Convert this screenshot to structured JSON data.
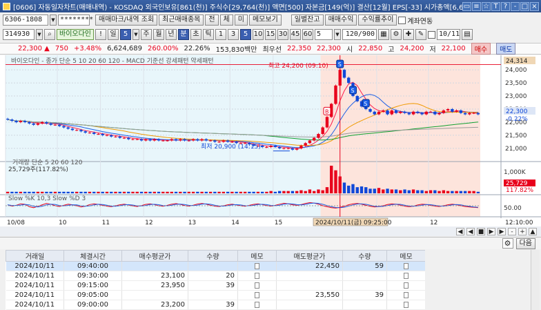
{
  "window": {
    "title": "[0606] 자동일자차트(매매내역) - KOSDAQ 외국인보유[861(천)] 주식수[29,764(천)] 액면[500] 자본금[149(억)] 결산[12월] EPS[-33] 시가총액[6,6",
    "controls": [
      "▭",
      "≡",
      "☆",
      "T",
      "?",
      "-",
      "□",
      "×"
    ]
  },
  "toolbar1": {
    "account": "6306-1808",
    "password": "********",
    "buttons": [
      {
        "label": "매매마크/내역 조회",
        "active": false
      },
      {
        "label": "최근매매종목",
        "active": false
      },
      {
        "label": "전",
        "active": false
      },
      {
        "label": "체",
        "active": false
      },
      {
        "label": "미",
        "active": false
      },
      {
        "label": "메모보기",
        "active": false
      },
      {
        "label": "일별잔고",
        "active": false
      },
      {
        "label": "매매수익",
        "active": false
      },
      {
        "label": "수익률추이",
        "active": false
      }
    ],
    "checkbox_label": "계좌연동"
  },
  "toolbar2": {
    "code": "314930",
    "stock_name": "바이오다인",
    "period_buttons": [
      {
        "label": "!",
        "active": false
      },
      {
        "label": "일",
        "active": false
      },
      {
        "label": "5",
        "active": true
      },
      {
        "label": "주",
        "active": false
      },
      {
        "label": "월",
        "active": false
      },
      {
        "label": "년",
        "active": false
      },
      {
        "label": "분",
        "active": true
      },
      {
        "label": "초",
        "active": false
      },
      {
        "label": "틱",
        "active": false
      },
      {
        "label": "1",
        "active": false
      },
      {
        "label": "3",
        "active": false
      },
      {
        "label": "5",
        "active": true
      },
      {
        "label": "10",
        "active": false
      },
      {
        "label": "15",
        "active": false
      },
      {
        "label": "30",
        "active": false
      },
      {
        "label": "45",
        "active": false
      },
      {
        "label": "60",
        "active": false
      }
    ],
    "count": "5",
    "range": "120/900",
    "date": "10/11"
  },
  "pricebar": {
    "price": "22,300",
    "change": "750",
    "change_pct": "+3.48%",
    "volume": "6,624,689",
    "vol_ratio": "260.00%",
    "turnover": "22.26%",
    "amount": "153,830백만",
    "best_ask_label": "최우선",
    "best_ask": "22,350",
    "best_bid": "22,300",
    "open_label": "시",
    "open": "22,850",
    "high_label": "고",
    "high": "24,200",
    "low_label": "저",
    "low": "22,100",
    "buy_label": "매수",
    "sell_label": "매도"
  },
  "chart": {
    "legend_main": "바이오다인 - 종가 단순 5  10  20  60  120  -  MACD 기준선 강세패턴 약세패턴",
    "legend_volume": "거래량 단순 5  20  60  120",
    "volume_total": "25,729주(117.82%)",
    "legend_stoch": "Slow %K 10,3  Slow %D 3",
    "high_annotation": "최고 24,200 (09:10)",
    "low_annotation": "최저 20,900 (14:15)",
    "crosshair_label": "2024/10/11(금) 09:25:00",
    "current_price_tag": "24,314",
    "last_price_tag": "22,300",
    "last_pct_tag": "-0.22%",
    "vol_max_label": "1,000K",
    "vol_last_tag": "25,729",
    "vol_pct_tag": "117.82%",
    "stoch_label": "50.00",
    "x_ticks": [
      "10/08",
      "10",
      "11",
      "12",
      "13",
      "14",
      "15",
      "11",
      "12",
      "12:10:00"
    ],
    "nav_buttons": [
      "◀",
      "◀",
      "■",
      "▶",
      "▶",
      "-",
      "+",
      "▲"
    ]
  },
  "chart_data": {
    "type": "candlestick",
    "title": "바이오다인",
    "y_axis": {
      "ticks": [
        21000,
        21500,
        22000,
        22500,
        23000,
        23500,
        24000
      ],
      "ylim": [
        20600,
        24400
      ]
    },
    "high": 24200,
    "low": 20900,
    "last": 22300,
    "close_series": [
      22100,
      22050,
      22000,
      22050,
      22000,
      21950,
      21900,
      21950,
      22000,
      21950,
      21900,
      21900,
      21850,
      21800,
      21750,
      21700,
      21700,
      21650,
      21600,
      21600,
      21550,
      21550,
      21500,
      21500,
      21450,
      21450,
      21400,
      21400,
      21350,
      21350,
      21350,
      21300,
      21350,
      21300,
      21350,
      21300,
      21300,
      21300,
      21350,
      21300,
      21350,
      21300,
      21300,
      21350,
      21300,
      21350,
      21300,
      21300,
      21250,
      21250,
      21300,
      21250,
      21250,
      21200,
      21200,
      21200,
      21150,
      21100,
      21100,
      21050,
      21050,
      21100,
      21050,
      21000,
      21000,
      21000,
      20950,
      21000,
      21100,
      21200,
      21300,
      21400,
      21550,
      21800,
      22200,
      22700,
      23400,
      24000,
      23700,
      23500,
      23000,
      22800,
      22600,
      22500,
      22400,
      22300,
      22400,
      22450,
      22300,
      22450,
      22350,
      22400,
      22350,
      22300,
      22400,
      22350,
      22300,
      22400,
      22400,
      22300,
      22350,
      22450,
      22500,
      22400,
      22450,
      22350,
      22300,
      22350,
      22350,
      22300
    ],
    "volume_series": [
      2,
      2,
      2,
      2,
      2,
      2,
      2,
      2,
      2,
      2,
      2,
      2,
      2,
      2,
      2,
      2,
      2,
      2,
      2,
      2,
      2,
      2,
      2,
      2,
      2,
      2,
      2,
      2,
      2,
      2,
      2,
      2,
      2,
      2,
      2,
      2,
      2,
      2,
      2,
      2,
      2,
      2,
      2,
      2,
      2,
      2,
      2,
      2,
      2,
      2,
      2,
      2,
      2,
      2,
      2,
      2,
      2,
      2,
      2,
      2,
      2,
      3,
      2,
      3,
      3,
      3,
      3,
      3,
      4,
      3,
      5,
      3,
      5,
      4,
      8,
      36,
      30,
      22,
      14,
      10,
      12,
      8,
      9,
      8,
      6,
      6,
      7,
      5,
      6,
      5,
      5,
      4,
      5,
      4,
      5,
      4,
      4,
      3,
      4,
      4,
      3,
      4,
      3,
      3,
      3,
      3,
      3,
      3,
      3,
      2
    ],
    "stoch_k": [
      55,
      48,
      52,
      60,
      58,
      45,
      40,
      47,
      55,
      62,
      58,
      50,
      46,
      52,
      58,
      55,
      50,
      44,
      48,
      56,
      60,
      57,
      52,
      48,
      45,
      50,
      55,
      58,
      54,
      49,
      46,
      51,
      57,
      60,
      56,
      50,
      47,
      52,
      58,
      61,
      57,
      51,
      48,
      53,
      59,
      62,
      58,
      52,
      48,
      46,
      50,
      55,
      58,
      54,
      50,
      47,
      52,
      57,
      60,
      56,
      51,
      48,
      52,
      58,
      63,
      60,
      55,
      52,
      56,
      62,
      66,
      64,
      58,
      50,
      45,
      40,
      38,
      42,
      48,
      55,
      60,
      62,
      58,
      52,
      47,
      44,
      46,
      50,
      56,
      60,
      58,
      53,
      48,
      45,
      48,
      54,
      58,
      56,
      52,
      48,
      46,
      50,
      55,
      58,
      55,
      50,
      46,
      44,
      42,
      40
    ],
    "mark_labels": [
      "B",
      "S",
      "S",
      "S"
    ]
  },
  "table": {
    "headers": [
      "거래일",
      "체결시간",
      "매수평균가",
      "수량",
      "메모",
      "매도평균가",
      "수량",
      "메모"
    ],
    "rows": [
      [
        "2024/10/11",
        "09:40:00",
        "",
        "",
        "",
        "22,450",
        "59",
        ""
      ],
      [
        "2024/10/11",
        "09:30:00",
        "23,100",
        "20",
        "",
        "",
        "",
        ""
      ],
      [
        "2024/10/11",
        "09:15:00",
        "23,950",
        "39",
        "",
        "",
        "",
        ""
      ],
      [
        "2024/10/11",
        "09:05:00",
        "",
        "",
        "",
        "23,550",
        "39",
        ""
      ],
      [
        "2024/10/11",
        "09:00:00",
        "23,200",
        "39",
        "",
        "",
        "",
        ""
      ]
    ],
    "next_label": "다음"
  },
  "colors": {
    "up": "#e8001c",
    "down": "#1048d8",
    "pre_session_bg": "#e8f6fb",
    "session_bg": "#fde4dc",
    "ma5": "#ff1a4a",
    "ma10": "#1b5fe6",
    "ma20": "#f09a00",
    "ma60": "#10a030",
    "ma120": "#9a9a9a"
  }
}
